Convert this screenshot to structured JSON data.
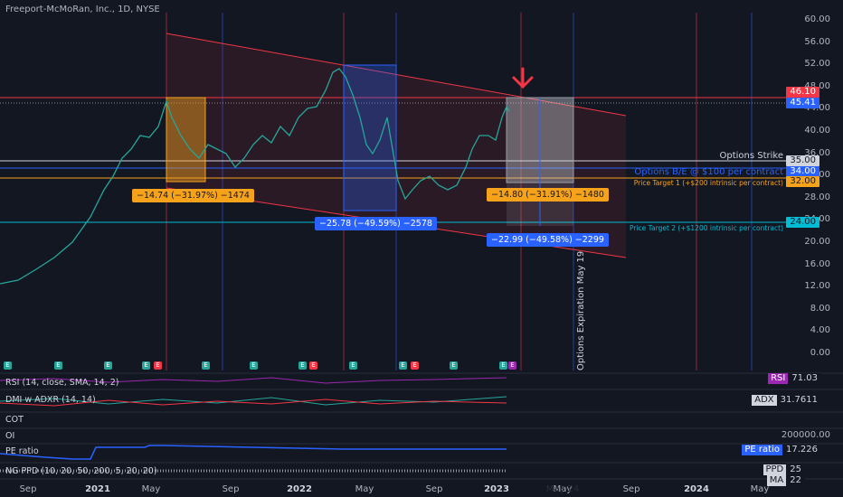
{
  "header": {
    "title": "Freeport-McMoRan, Inc., 1D, NYSE"
  },
  "price_axis": {
    "labels": [
      "60.00",
      "56.00",
      "52.00",
      "48.00",
      "44.00",
      "40.00",
      "36.00",
      "32.00",
      "28.00",
      "24.00",
      "20.00",
      "16.00",
      "12.00",
      "8.00",
      "4.00",
      "0.00"
    ]
  },
  "time_axis": {
    "labels": [
      "Sep",
      "2021",
      "May",
      "Sep",
      "2022",
      "May",
      "Sep",
      "2023",
      "May",
      "Sep",
      "2024",
      "May"
    ],
    "hidden_label": "May 24"
  },
  "price_tags": {
    "resistance": "46.10",
    "last": "45.41",
    "strike": "35.00",
    "breakeven": "34.00",
    "target1": "32.00",
    "target2": "24.00"
  },
  "annotations": {
    "strike": "Options Strike",
    "breakeven": "Options B/E @ $100 per contract",
    "target1": "Price Target 1 (+$200 intrinsic per contract)",
    "target2": "Price Target 2 (+$1200 intrinsic per contract)",
    "expiration": "Options Expiration May 19"
  },
  "measures": {
    "m1": "−14.74 (−31.97%) −1474",
    "m2": "−25.78 (−49.59%) −2578",
    "m3": "−14.80 (−31.91%) −1480",
    "m4": "−22.99 (−49.58%) −2299"
  },
  "markers": {
    "earnings": "E",
    "event": "E"
  },
  "panes": {
    "rsi": {
      "label": "RSI (14, close, SMA, 14, 2)",
      "tag": "RSI",
      "value": "71.03"
    },
    "dmi": {
      "label": "DMI w ADXR (14, 14)",
      "tag": "ADX",
      "value": "31.7611"
    },
    "cot": {
      "label": "COT"
    },
    "oi": {
      "label": "OI",
      "axis_value": "200000.00"
    },
    "pe": {
      "label": "PE ratio",
      "tag": "PE ratio",
      "value": "17.226"
    },
    "ppd": {
      "label": "NG PPD (10, 20, 50, 200, 5, 20, 20)",
      "tag1": "PPD",
      "value1": "25",
      "tag2": "MA",
      "value2": "22"
    }
  },
  "colors": {
    "bg": "#131722",
    "red": "#f23645",
    "blue": "#2962ff",
    "orange": "#f7a21b",
    "cyan": "#00bcd4",
    "green": "#26a69a"
  }
}
